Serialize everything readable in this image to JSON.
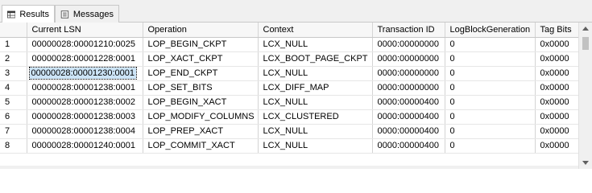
{
  "tabs": [
    {
      "label": "Results",
      "icon": "grid-icon",
      "active": true
    },
    {
      "label": "Messages",
      "icon": "messages-icon",
      "active": false
    }
  ],
  "columns": [
    "",
    "Current LSN",
    "Operation",
    "Context",
    "Transaction ID",
    "LogBlockGeneration",
    "Tag Bits"
  ],
  "rows": [
    [
      "1",
      "00000028:00001210:0025",
      "LOP_BEGIN_CKPT",
      "LCX_NULL",
      "0000:00000000",
      "0",
      "0x0000"
    ],
    [
      "2",
      "00000028:00001228:0001",
      "LOP_XACT_CKPT",
      "LCX_BOOT_PAGE_CKPT",
      "0000:00000000",
      "0",
      "0x0000"
    ],
    [
      "3",
      "00000028:00001230:0001",
      "LOP_END_CKPT",
      "LCX_NULL",
      "0000:00000000",
      "0",
      "0x0000"
    ],
    [
      "4",
      "00000028:00001238:0001",
      "LOP_SET_BITS",
      "LCX_DIFF_MAP",
      "0000:00000000",
      "0",
      "0x0000"
    ],
    [
      "5",
      "00000028:00001238:0002",
      "LOP_BEGIN_XACT",
      "LCX_NULL",
      "0000:00000400",
      "0",
      "0x0000"
    ],
    [
      "6",
      "00000028:00001238:0003",
      "LOP_MODIFY_COLUMNS",
      "LCX_CLUSTERED",
      "0000:00000400",
      "0",
      "0x0000"
    ],
    [
      "7",
      "00000028:00001238:0004",
      "LOP_PREP_XACT",
      "LCX_NULL",
      "0000:00000400",
      "0",
      "0x0000"
    ],
    [
      "8",
      "00000028:00001240:0001",
      "LOP_COMMIT_XACT",
      "LCX_NULL",
      "0000:00000400",
      "0",
      "0x0000"
    ]
  ],
  "selected": {
    "row": 2,
    "col": 1
  },
  "colors": {
    "selection": "#cce4f7",
    "header_bg": "#f7f7f7",
    "grid_line": "#d4d4d4"
  }
}
